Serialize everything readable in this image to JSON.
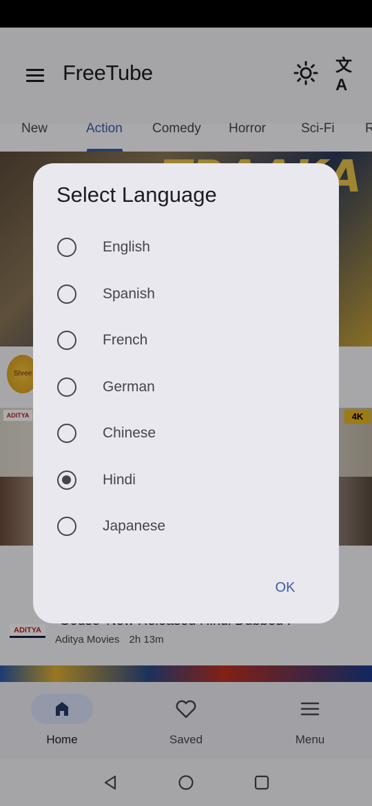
{
  "app": {
    "title": "FreeTube",
    "theme_icon": "sun-icon",
    "translate_icon": "translate-icon",
    "translate_glyph": "文A",
    "menu_icon": "hamburger-menu-icon"
  },
  "tabs": [
    {
      "label": "New"
    },
    {
      "label": "Action",
      "active": true
    },
    {
      "label": "Comedy"
    },
    {
      "label": "Horror"
    },
    {
      "label": "Sci-Fi"
    },
    {
      "label": "R"
    }
  ],
  "content": {
    "poster_text": "TRAAKA",
    "channel_badge": "ADITYA",
    "quality_badge": "4K",
    "video_title": "Godse 'New Released Hindi Dubbed I",
    "channel_name": "Aditya Movies",
    "duration": "2h 13m"
  },
  "dialog": {
    "title": "Select Language",
    "options": [
      {
        "label": "English",
        "selected": false
      },
      {
        "label": "Spanish",
        "selected": false
      },
      {
        "label": "French",
        "selected": false
      },
      {
        "label": "German",
        "selected": false
      },
      {
        "label": "Chinese",
        "selected": false
      },
      {
        "label": "Hindi",
        "selected": true
      },
      {
        "label": "Japanese",
        "selected": false
      }
    ],
    "confirm_label": "OK"
  },
  "bottom_nav": [
    {
      "label": "Home",
      "icon": "home-icon",
      "active": true
    },
    {
      "label": "Saved",
      "icon": "heart-icon",
      "active": false
    },
    {
      "label": "Menu",
      "icon": "menu-icon",
      "active": false
    }
  ],
  "colors": {
    "accent": "#3b5ba8",
    "dialog_bg": "#e8e8ee",
    "nav_pill": "#d9e2f8"
  }
}
